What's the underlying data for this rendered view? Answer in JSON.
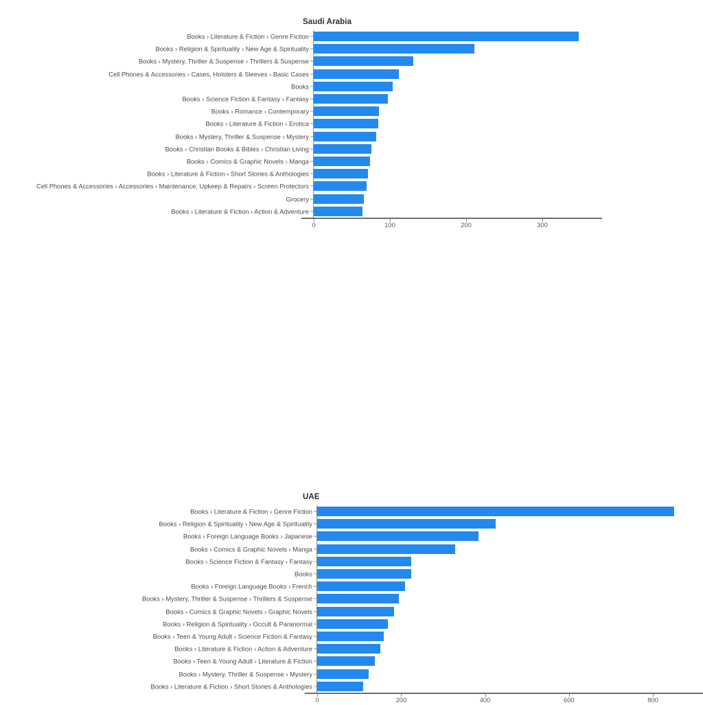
{
  "figure": {
    "background": "#ffffff",
    "bar_color": "#2389ef",
    "axis_color": "#6e6e6e",
    "label_color": "#4a4a4a"
  },
  "chart_data": [
    {
      "type": "bar",
      "orientation": "horizontal",
      "title": "Saudi Arabia",
      "xlabel": "",
      "ylabel": "",
      "xlim": [
        0,
        355
      ],
      "xticks": [
        0,
        100,
        200,
        300
      ],
      "xtick_labels": [
        "0",
        "100",
        "200",
        "300"
      ],
      "grid": false,
      "legend": false,
      "categories": [
        "Books › Literature & Fiction › Genre Fiction",
        "Books › Religion & Spirituality › New Age & Spirituality",
        "Books › Mystery, Thriller & Suspense › Thrillers & Suspense",
        "Cell Phones & Accessories › Cases, Holsters & Sleeves › Basic Cases",
        "Books",
        "Books › Science Fiction & Fantasy › Fantasy",
        "Books › Romance › Contemporary",
        "Books › Literature & Fiction › Erotica",
        "Books › Mystery, Thriller & Suspense › Mystery",
        "Books › Christian Books & Bibles › Christian Living",
        "Books › Comics & Graphic Novels › Manga",
        "Books › Literature & Fiction › Short Stories & Anthologies",
        "Cell Phones & Accessories › Accessories › Maintenance, Upkeep & Repairs › Screen Protectors",
        "Grocery",
        "Books › Literature & Fiction › Action & Adventure"
      ],
      "values": [
        348,
        211,
        131,
        112,
        104,
        97,
        86,
        85,
        82,
        76,
        74,
        71,
        69,
        66,
        64
      ]
    },
    {
      "type": "bar",
      "orientation": "horizontal",
      "title": "UAE",
      "xlabel": "",
      "ylabel": "",
      "xlim": [
        0,
        880
      ],
      "xticks": [
        0,
        200,
        400,
        600,
        800
      ],
      "xtick_labels": [
        "0",
        "200",
        "400",
        "600",
        "800"
      ],
      "grid": false,
      "legend": false,
      "categories": [
        "Books › Literature & Fiction › Genre Fiction",
        "Books › Religion & Spirituality › New Age & Spirituality",
        "Books › Foreign Language Books › Japanese",
        "Books › Comics & Graphic Novels › Manga",
        "Books › Science Fiction & Fantasy › Fantasy",
        "Books",
        "Books › Foreign Language Books › French",
        "Books › Mystery, Thriller & Suspense › Thrillers & Suspense",
        "Books › Comics & Graphic Novels › Graphic Novels",
        "Books › Religion & Spirituality › Occult & Paranormal",
        "Books › Teen & Young Adult › Science Fiction & Fantasy",
        "Books › Literature & Fiction › Action & Adventure",
        "Books › Teen & Young Adult › Literature & Fiction",
        "Books › Mystery, Thriller & Suspense › Mystery",
        "Books › Literature & Fiction › Short Stories & Anthologies"
      ],
      "values": [
        851,
        426,
        385,
        328,
        224,
        224,
        210,
        194,
        184,
        168,
        158,
        150,
        137,
        122,
        109
      ]
    }
  ]
}
